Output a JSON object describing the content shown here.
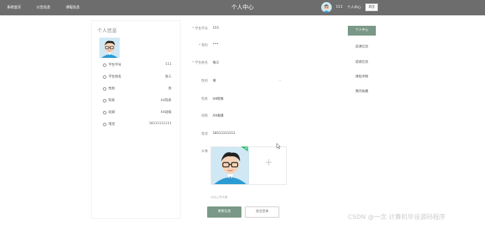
{
  "nav": {
    "home": "系统首页",
    "notices": "公告信息",
    "courses": "课程信息"
  },
  "header": {
    "title": "个人中心",
    "username": "111",
    "center": "个人中心",
    "logout": "退出"
  },
  "profile_card": {
    "title": "个人信息",
    "rows": [
      {
        "label": "学生学号",
        "value": "111"
      },
      {
        "label": "学生姓名",
        "value": "张三"
      },
      {
        "label": "性别",
        "value": "男"
      },
      {
        "label": "院系",
        "value": "XX院系"
      },
      {
        "label": "班级",
        "value": "XX班级"
      },
      {
        "label": "电话",
        "value": "18111111111"
      }
    ]
  },
  "form": {
    "student_id_label": "学生学号",
    "student_id_value": "111",
    "password_label": "密码",
    "password_value": "•••",
    "name_label": "学生姓名",
    "name_value": "张三",
    "gender_label": "性别",
    "gender_value": "男",
    "dept_label": "院系",
    "dept_value": "XX院系",
    "class_label": "班级",
    "class_value": "XX班级",
    "phone_label": "电话",
    "phone_value": "18111111111",
    "avatar_label": "头像",
    "upload_hint": "点击上传头像",
    "update_button": "更新信息",
    "logout_button": "退出登录"
  },
  "sidebar": {
    "items": [
      {
        "label": "个人中心",
        "active": true
      },
      {
        "label": "选课信息"
      },
      {
        "label": "成绩信息"
      },
      {
        "label": "课程评教"
      },
      {
        "label": "我的收藏"
      }
    ]
  },
  "watermark": "CSDN @一念 计算机毕设源码程序",
  "colors": {
    "topbar": "#6d6d6d",
    "accent": "#7a9887",
    "required": "#e05555"
  },
  "icons": {
    "avatar": "cartoon-avatar-icon",
    "row": "circle-bullet-icon",
    "upload": "plus-icon",
    "cursor": "mouse-cursor-icon"
  }
}
